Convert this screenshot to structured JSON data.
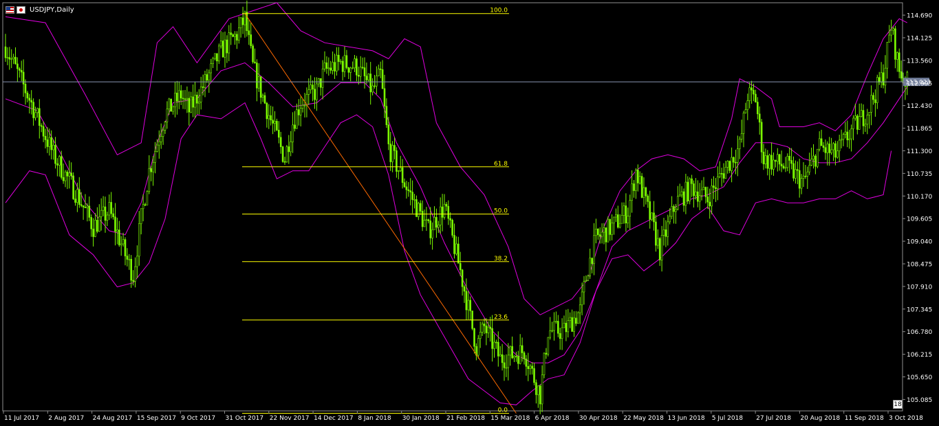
{
  "window": {
    "title": "USDJPY,Daily",
    "badge": "18"
  },
  "colors": {
    "background": "#000000",
    "candle": "#7CFC00",
    "band": "#E100E1",
    "fibo": "#FFFF00",
    "trend": "#FF6A00",
    "current_line": "#8A96B4",
    "text": "#FFFFFF"
  },
  "chart_data": {
    "type": "candlestick",
    "symbol": "USDJPY",
    "timeframe": "Daily",
    "ylim": [
      104.8,
      115.0
    ],
    "y_ticks": [
      "114.690",
      "114.125",
      "113.560",
      "112.995",
      "112.430",
      "111.865",
      "111.300",
      "110.735",
      "110.170",
      "109.605",
      "109.040",
      "108.475",
      "107.910",
      "107.345",
      "106.780",
      "106.215",
      "105.650",
      "105.085"
    ],
    "x_ticks": [
      "11 Jul 2017",
      "2 Aug 2017",
      "24 Aug 2017",
      "15 Sep 2017",
      "9 Oct 2017",
      "31 Oct 2017",
      "22 Nov 2017",
      "14 Dec 2017",
      "8 Jan 2018",
      "30 Jan 2018",
      "21 Feb 2018",
      "15 Mar 2018",
      "6 Apr 2018",
      "30 Apr 2018",
      "22 May 2018",
      "13 Jun 2018",
      "5 Jul 2018",
      "27 Jul 2018",
      "20 Aug 2018",
      "11 Sep 2018",
      "3 Oct 2018"
    ],
    "current_price": "113.023",
    "close_path": [
      [
        0,
        113.9
      ],
      [
        3,
        112.6
      ],
      [
        6,
        111.2
      ],
      [
        9,
        110.2
      ],
      [
        11,
        109.4
      ],
      [
        13,
        109.8
      ],
      [
        15,
        108.7
      ],
      [
        16,
        108.2
      ],
      [
        17,
        109.6
      ],
      [
        18,
        110.8
      ],
      [
        20,
        112.2
      ],
      [
        22,
        112.7
      ],
      [
        23,
        112.3
      ],
      [
        25,
        113.0
      ],
      [
        27,
        113.8
      ],
      [
        29,
        114.2
      ],
      [
        30,
        114.6
      ],
      [
        31,
        113.4
      ],
      [
        33,
        112.2
      ],
      [
        35,
        111.1
      ],
      [
        36,
        112.0
      ],
      [
        37,
        112.5
      ],
      [
        39,
        112.8
      ],
      [
        40,
        113.3
      ],
      [
        42,
        113.5
      ],
      [
        44,
        113.4
      ],
      [
        46,
        112.8
      ],
      [
        47,
        113.2
      ],
      [
        48,
        111.4
      ],
      [
        50,
        110.5
      ],
      [
        53,
        109.3
      ],
      [
        55,
        109.9
      ],
      [
        57,
        108.3
      ],
      [
        59,
        106.4
      ],
      [
        60,
        106.9
      ],
      [
        62,
        106.1
      ],
      [
        65,
        106.3
      ],
      [
        67,
        105.2
      ],
      [
        68,
        106.8
      ],
      [
        70,
        106.8
      ],
      [
        72,
        107.3
      ],
      [
        73,
        108.4
      ],
      [
        74,
        109.1
      ],
      [
        76,
        109.4
      ],
      [
        78,
        109.8
      ],
      [
        79,
        110.8
      ],
      [
        81,
        109.5
      ],
      [
        82,
        108.8
      ],
      [
        84,
        110.0
      ],
      [
        86,
        110.4
      ],
      [
        88,
        110.1
      ],
      [
        90,
        110.8
      ],
      [
        92,
        111.4
      ],
      [
        93,
        112.7
      ],
      [
        94,
        112.6
      ],
      [
        95,
        111.1
      ],
      [
        98,
        110.9
      ],
      [
        100,
        110.5
      ],
      [
        102,
        111.4
      ],
      [
        104,
        111.2
      ],
      [
        106,
        111.8
      ],
      [
        108,
        112.3
      ],
      [
        110,
        113.2
      ],
      [
        111,
        114.4
      ],
      [
        112,
        113.3
      ],
      [
        113,
        113.0
      ]
    ],
    "bollinger": {
      "upper": [
        [
          0,
          114.65
        ],
        [
          5,
          114.5
        ],
        [
          10,
          112.7
        ],
        [
          14,
          111.2
        ],
        [
          17,
          111.5
        ],
        [
          19,
          114.0
        ],
        [
          21,
          114.4
        ],
        [
          24,
          113.5
        ],
        [
          28,
          114.6
        ],
        [
          31,
          114.8
        ],
        [
          34,
          115.0
        ],
        [
          37,
          114.3
        ],
        [
          40,
          114.0
        ],
        [
          43,
          113.9
        ],
        [
          46,
          113.8
        ],
        [
          48,
          113.6
        ],
        [
          50,
          114.1
        ],
        [
          52,
          113.9
        ],
        [
          54,
          112.0
        ],
        [
          57,
          110.9
        ],
        [
          60,
          110.2
        ],
        [
          63,
          108.9
        ],
        [
          65,
          107.6
        ],
        [
          67,
          107.2
        ],
        [
          69,
          107.4
        ],
        [
          71,
          107.6
        ],
        [
          73,
          108.1
        ],
        [
          75,
          109.4
        ],
        [
          77,
          110.3
        ],
        [
          79,
          110.8
        ],
        [
          81,
          111.1
        ],
        [
          83,
          111.2
        ],
        [
          85,
          111.1
        ],
        [
          87,
          110.8
        ],
        [
          89,
          110.9
        ],
        [
          91,
          112.1
        ],
        [
          92,
          113.1
        ],
        [
          94,
          112.9
        ],
        [
          96,
          112.6
        ],
        [
          97,
          111.9
        ],
        [
          100,
          111.9
        ],
        [
          102,
          112.0
        ],
        [
          104,
          111.8
        ],
        [
          106,
          112.2
        ],
        [
          108,
          113.2
        ],
        [
          110,
          114.1
        ],
        [
          112,
          114.6
        ],
        [
          113,
          114.5
        ]
      ],
      "middle": [
        [
          0,
          112.6
        ],
        [
          4,
          112.3
        ],
        [
          7,
          111.2
        ],
        [
          10,
          110.0
        ],
        [
          13,
          109.3
        ],
        [
          15,
          109.2
        ],
        [
          17,
          110.0
        ],
        [
          19,
          111.5
        ],
        [
          21,
          112.5
        ],
        [
          24,
          112.6
        ],
        [
          27,
          113.3
        ],
        [
          30,
          113.5
        ],
        [
          33,
          113.0
        ],
        [
          36,
          112.4
        ],
        [
          39,
          112.5
        ],
        [
          42,
          113.0
        ],
        [
          45,
          113.0
        ],
        [
          47,
          112.6
        ],
        [
          49,
          111.5
        ],
        [
          52,
          110.4
        ],
        [
          55,
          109.0
        ],
        [
          58,
          107.8
        ],
        [
          61,
          106.8
        ],
        [
          64,
          106.2
        ],
        [
          66,
          106.0
        ],
        [
          68,
          106.0
        ],
        [
          70,
          106.2
        ],
        [
          72,
          106.8
        ],
        [
          74,
          107.8
        ],
        [
          76,
          108.9
        ],
        [
          78,
          109.3
        ],
        [
          80,
          109.5
        ],
        [
          82,
          109.7
        ],
        [
          84,
          109.9
        ],
        [
          86,
          110.1
        ],
        [
          88,
          110.2
        ],
        [
          90,
          110.4
        ],
        [
          92,
          111.0
        ],
        [
          94,
          111.5
        ],
        [
          96,
          111.5
        ],
        [
          98,
          111.4
        ],
        [
          100,
          111.1
        ],
        [
          102,
          111.0
        ],
        [
          104,
          111.0
        ],
        [
          106,
          111.1
        ],
        [
          108,
          111.5
        ],
        [
          110,
          112.0
        ],
        [
          112,
          112.6
        ],
        [
          113,
          112.9
        ]
      ],
      "lower": [
        [
          0,
          110.0
        ],
        [
          3,
          110.8
        ],
        [
          5,
          110.7
        ],
        [
          8,
          109.2
        ],
        [
          11,
          108.7
        ],
        [
          14,
          107.9
        ],
        [
          16,
          108.0
        ],
        [
          18,
          108.5
        ],
        [
          20,
          109.6
        ],
        [
          22,
          111.6
        ],
        [
          24,
          112.2
        ],
        [
          27,
          112.1
        ],
        [
          30,
          112.5
        ],
        [
          32,
          111.6
        ],
        [
          34,
          110.6
        ],
        [
          36,
          110.8
        ],
        [
          38,
          110.8
        ],
        [
          40,
          111.4
        ],
        [
          42,
          112.0
        ],
        [
          44,
          112.2
        ],
        [
          46,
          111.9
        ],
        [
          48,
          110.7
        ],
        [
          50,
          108.8
        ],
        [
          52,
          107.7
        ],
        [
          54,
          107.0
        ],
        [
          56,
          106.3
        ],
        [
          58,
          105.6
        ],
        [
          60,
          105.3
        ],
        [
          62,
          105.0
        ],
        [
          64,
          104.95
        ],
        [
          66,
          105.3
        ],
        [
          68,
          105.6
        ],
        [
          70,
          105.7
        ],
        [
          72,
          106.5
        ],
        [
          74,
          107.8
        ],
        [
          76,
          108.6
        ],
        [
          78,
          108.7
        ],
        [
          80,
          108.3
        ],
        [
          82,
          108.6
        ],
        [
          84,
          109.0
        ],
        [
          86,
          109.6
        ],
        [
          88,
          109.9
        ],
        [
          90,
          109.3
        ],
        [
          92,
          109.2
        ],
        [
          94,
          110.0
        ],
        [
          96,
          110.1
        ],
        [
          98,
          110.0
        ],
        [
          100,
          110.0
        ],
        [
          102,
          110.1
        ],
        [
          104,
          110.1
        ],
        [
          106,
          110.3
        ],
        [
          108,
          110.1
        ],
        [
          110,
          110.2
        ],
        [
          111,
          111.3
        ]
      ]
    },
    "fibonacci": {
      "from": {
        "x": 30,
        "price": 114.73
      },
      "to": {
        "x": 64,
        "price": 104.74
      },
      "levels": [
        {
          "label": "100.0",
          "price": 114.73
        },
        {
          "label": "61.8",
          "price": 110.9
        },
        {
          "label": "50.0",
          "price": 109.72
        },
        {
          "label": "38.2",
          "price": 108.53
        },
        {
          "label": "23.6",
          "price": 107.07
        },
        {
          "label": "0.0",
          "price": 104.74
        }
      ]
    }
  }
}
